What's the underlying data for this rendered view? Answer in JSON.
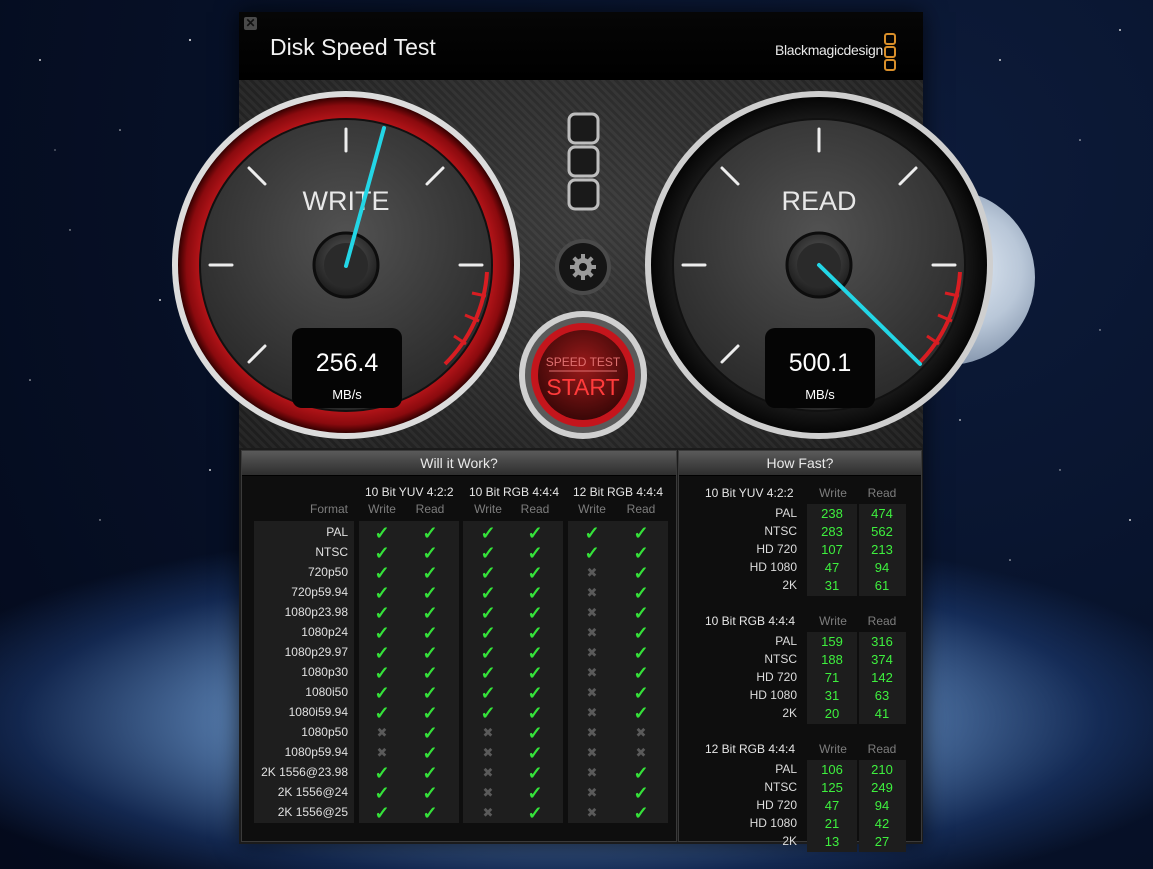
{
  "window": {
    "close_icon": "close-icon",
    "title": "Disk Speed Test",
    "brand": "Blackmagicdesign"
  },
  "gauges": {
    "write": {
      "label": "WRITE",
      "value": "256.4",
      "unit": "MB/s"
    },
    "read": {
      "label": "READ",
      "value": "500.1",
      "unit": "MB/s"
    }
  },
  "controls": {
    "settings_icon": "gear-icon",
    "start_top": "SPEED TEST",
    "start_main": "START"
  },
  "will_it_work": {
    "title": "Will it Work?",
    "format_header": "Format",
    "groups": [
      "10 Bit YUV 4:2:2",
      "10 Bit RGB 4:4:4",
      "12 Bit RGB 4:4:4"
    ],
    "write_label": "Write",
    "read_label": "Read",
    "rows": [
      {
        "format": "PAL",
        "marks": [
          1,
          1,
          1,
          1,
          1,
          1
        ]
      },
      {
        "format": "NTSC",
        "marks": [
          1,
          1,
          1,
          1,
          1,
          1
        ]
      },
      {
        "format": "720p50",
        "marks": [
          1,
          1,
          1,
          1,
          0,
          1
        ]
      },
      {
        "format": "720p59.94",
        "marks": [
          1,
          1,
          1,
          1,
          0,
          1
        ]
      },
      {
        "format": "1080p23.98",
        "marks": [
          1,
          1,
          1,
          1,
          0,
          1
        ]
      },
      {
        "format": "1080p24",
        "marks": [
          1,
          1,
          1,
          1,
          0,
          1
        ]
      },
      {
        "format": "1080p29.97",
        "marks": [
          1,
          1,
          1,
          1,
          0,
          1
        ]
      },
      {
        "format": "1080p30",
        "marks": [
          1,
          1,
          1,
          1,
          0,
          1
        ]
      },
      {
        "format": "1080i50",
        "marks": [
          1,
          1,
          1,
          1,
          0,
          1
        ]
      },
      {
        "format": "1080i59.94",
        "marks": [
          1,
          1,
          1,
          1,
          0,
          1
        ]
      },
      {
        "format": "1080p50",
        "marks": [
          0,
          1,
          0,
          1,
          0,
          0
        ]
      },
      {
        "format": "1080p59.94",
        "marks": [
          0,
          1,
          0,
          1,
          0,
          0
        ]
      },
      {
        "format": "2K 1556@23.98",
        "marks": [
          1,
          1,
          0,
          1,
          0,
          1
        ]
      },
      {
        "format": "2K 1556@24",
        "marks": [
          1,
          1,
          0,
          1,
          0,
          1
        ]
      },
      {
        "format": "2K 1556@25",
        "marks": [
          1,
          1,
          0,
          1,
          0,
          1
        ]
      }
    ]
  },
  "how_fast": {
    "title": "How Fast?",
    "write_label": "Write",
    "read_label": "Read",
    "groups": [
      {
        "name": "10 Bit YUV 4:2:2",
        "rows": [
          {
            "format": "PAL",
            "write": "238",
            "read": "474"
          },
          {
            "format": "NTSC",
            "write": "283",
            "read": "562"
          },
          {
            "format": "HD 720",
            "write": "107",
            "read": "213"
          },
          {
            "format": "HD 1080",
            "write": "47",
            "read": "94"
          },
          {
            "format": "2K",
            "write": "31",
            "read": "61"
          }
        ]
      },
      {
        "name": "10 Bit RGB 4:4:4",
        "rows": [
          {
            "format": "PAL",
            "write": "159",
            "read": "316"
          },
          {
            "format": "NTSC",
            "write": "188",
            "read": "374"
          },
          {
            "format": "HD 720",
            "write": "71",
            "read": "142"
          },
          {
            "format": "HD 1080",
            "write": "31",
            "read": "63"
          },
          {
            "format": "2K",
            "write": "20",
            "read": "41"
          }
        ]
      },
      {
        "name": "12 Bit RGB 4:4:4",
        "rows": [
          {
            "format": "PAL",
            "write": "106",
            "read": "210"
          },
          {
            "format": "NTSC",
            "write": "125",
            "read": "249"
          },
          {
            "format": "HD 720",
            "write": "47",
            "read": "94"
          },
          {
            "format": "HD 1080",
            "write": "21",
            "read": "42"
          },
          {
            "format": "2K",
            "write": "13",
            "read": "27"
          }
        ]
      }
    ]
  },
  "colors": {
    "accent_red": "#c4151c",
    "needle": "#23d6e6",
    "check_green": "#35e23a",
    "brand_orange": "#d98f2a"
  }
}
